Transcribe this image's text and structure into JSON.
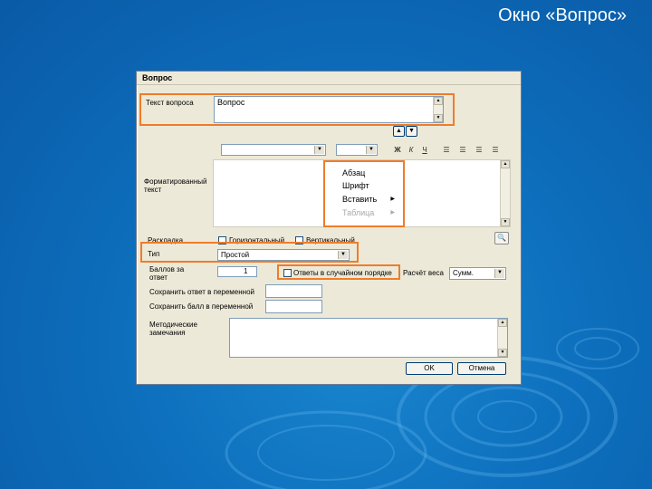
{
  "slide": {
    "title": "Окно «Вопрос»"
  },
  "dialog": {
    "title": "Вопрос",
    "question_text_label": "Текст вопроса",
    "question_text_value": "Вопрос",
    "toolbar": {
      "font_combo_value": "",
      "size_combo_value": "",
      "icons": [
        "bold-icon",
        "italic-icon",
        "underline-icon",
        "align-left-icon",
        "align-center-icon",
        "align-right-icon",
        "justify-icon"
      ],
      "bold": "Ж",
      "italic": "К",
      "underline": "Ч"
    },
    "formatted_text_label": "Форматированный текст",
    "context_menu": {
      "items": [
        {
          "label": "Абзац",
          "submenu": false,
          "disabled": false
        },
        {
          "label": "Шрифт",
          "submenu": false,
          "disabled": false
        },
        {
          "label": "Вставить",
          "submenu": true,
          "disabled": false
        },
        {
          "label": "Таблица",
          "submenu": true,
          "disabled": true
        }
      ]
    },
    "layout_label": "Раскладка",
    "horizontal_label": "Горизонтальный",
    "vertical_label": "Вертикальный",
    "type_label": "Тип",
    "type_value": "Простой",
    "points_label": "Баллов за ответ",
    "points_value": "1",
    "random_order_label": "Ответы в случайном порядке",
    "weight_label": "Расчёт веса",
    "weight_value": "Сумм.",
    "save_answer_label": "Сохранить ответ в переменной",
    "save_points_label": "Сохранить балл в переменной",
    "comments_label": "Методические замечания",
    "ok_label": "OK",
    "cancel_label": "Отмена"
  }
}
